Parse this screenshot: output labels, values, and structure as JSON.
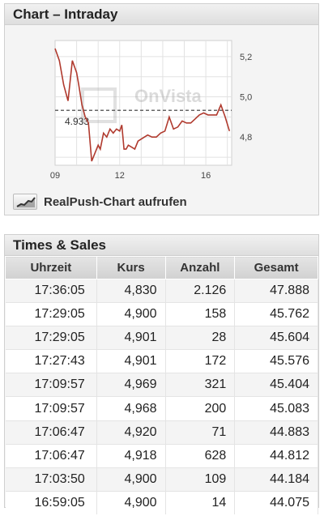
{
  "chart_panel": {
    "title": "Chart – Intraday",
    "watermark": "OnVista",
    "realpush_label": "RealPush-Chart aufrufen",
    "realpush_icon": "chart-trend-icon",
    "chart_data": {
      "type": "line",
      "title": "",
      "xlabel": "",
      "ylabel": "",
      "x_ticks": [
        "09",
        "12",
        "16"
      ],
      "y_ticks": [
        "5,2",
        "5,0",
        "4,8"
      ],
      "ylim": [
        4.66,
        5.28
      ],
      "reference_line": {
        "value": 4.933,
        "label": "4.933",
        "style": "dashed"
      },
      "line_color": "#b03a2e",
      "grid": true,
      "series": [
        {
          "x": [
            9.0,
            9.2,
            9.4,
            9.6,
            9.8,
            10.0,
            10.1,
            10.25,
            10.4,
            10.55,
            10.7,
            10.85,
            11.0,
            11.1,
            11.25,
            11.4,
            11.55,
            11.7,
            11.85,
            12.0,
            12.1,
            12.2,
            12.3,
            12.4,
            12.55,
            12.7,
            12.85,
            13.0,
            13.15,
            13.3,
            13.5,
            13.7,
            13.9,
            14.1,
            14.3,
            14.5,
            14.7,
            14.9,
            15.1,
            15.3,
            15.5,
            15.7,
            15.9,
            16.1,
            16.3,
            16.5,
            16.7,
            16.9,
            17.1
          ],
          "y": [
            5.24,
            5.18,
            5.06,
            4.98,
            5.18,
            5.12,
            5.06,
            4.96,
            4.9,
            4.87,
            4.68,
            4.72,
            4.76,
            4.74,
            4.82,
            4.8,
            4.84,
            4.82,
            4.84,
            4.83,
            4.86,
            4.74,
            4.74,
            4.76,
            4.75,
            4.74,
            4.78,
            4.79,
            4.8,
            4.81,
            4.8,
            4.8,
            4.82,
            4.83,
            4.9,
            4.84,
            4.85,
            4.88,
            4.87,
            4.87,
            4.89,
            4.91,
            4.92,
            4.91,
            4.91,
            4.91,
            4.96,
            4.9,
            4.83
          ]
        }
      ]
    }
  },
  "ts_panel": {
    "title": "Times & Sales",
    "columns": [
      "Uhrzeit",
      "Kurs",
      "Anzahl",
      "Gesamt"
    ],
    "rows": [
      [
        "17:36:05",
        "4,830",
        "2.126",
        "47.888"
      ],
      [
        "17:29:05",
        "4,900",
        "158",
        "45.762"
      ],
      [
        "17:29:05",
        "4,901",
        "28",
        "45.604"
      ],
      [
        "17:27:43",
        "4,901",
        "172",
        "45.576"
      ],
      [
        "17:09:57",
        "4,969",
        "321",
        "45.404"
      ],
      [
        "17:09:57",
        "4,968",
        "200",
        "45.083"
      ],
      [
        "17:06:47",
        "4,920",
        "71",
        "44.883"
      ],
      [
        "17:06:47",
        "4,918",
        "628",
        "44.812"
      ],
      [
        "17:03:50",
        "4,900",
        "109",
        "44.184"
      ],
      [
        "16:59:05",
        "4,900",
        "14",
        "44.075"
      ]
    ]
  }
}
